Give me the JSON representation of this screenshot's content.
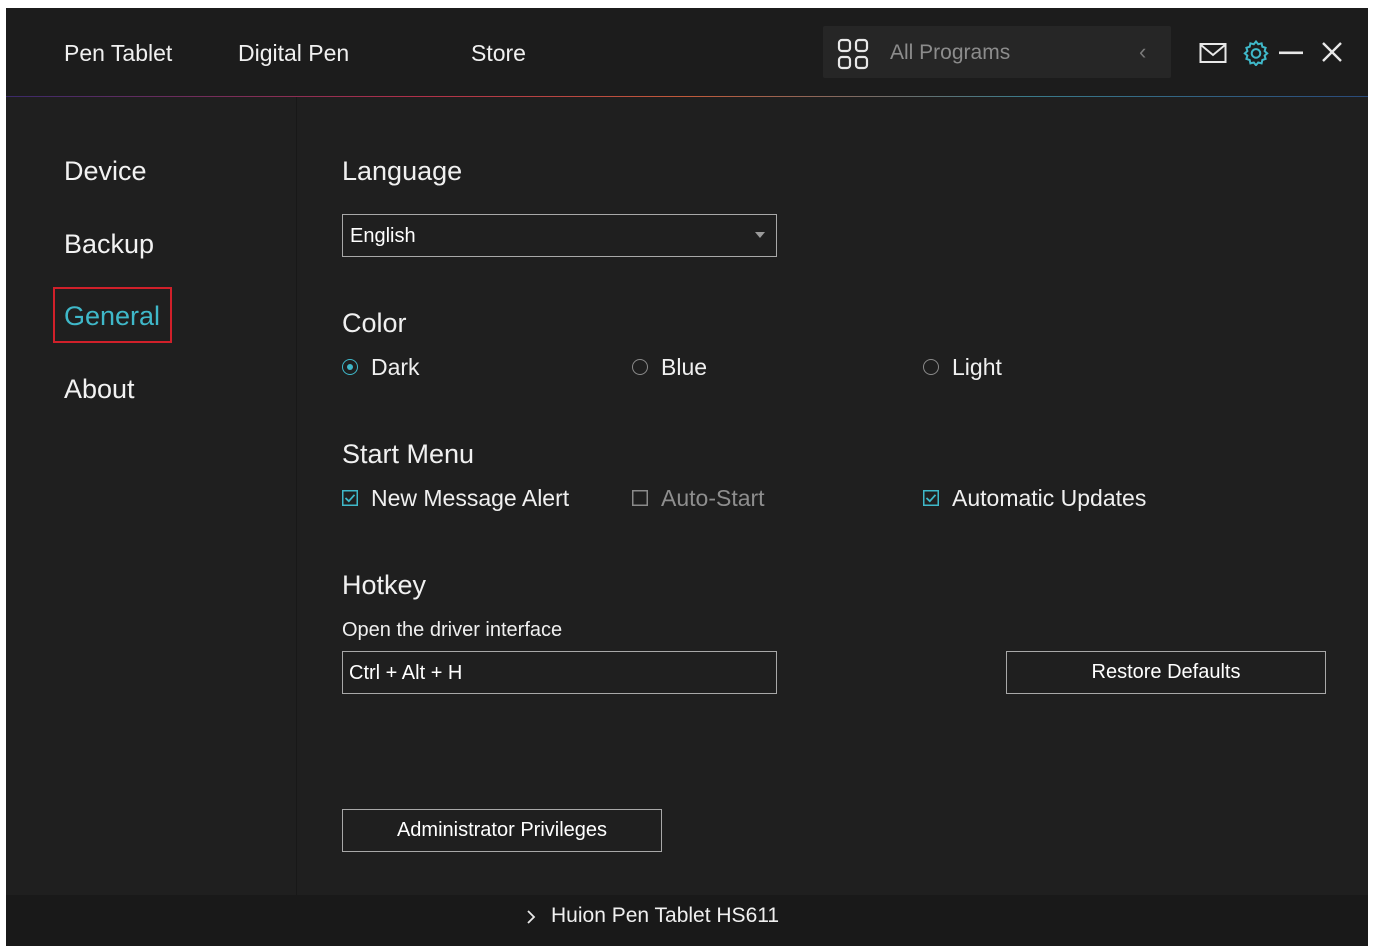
{
  "top_nav": {
    "tabs": [
      {
        "label": "Pen Tablet"
      },
      {
        "label": "Digital Pen"
      },
      {
        "label": "Store"
      }
    ],
    "program_selector": {
      "label": "All Programs"
    },
    "icons": [
      "grid-icon",
      "mail-icon",
      "gear-icon",
      "minimize-icon",
      "close-icon"
    ]
  },
  "sidebar": {
    "items": [
      {
        "label": "Device",
        "active": false
      },
      {
        "label": "Backup",
        "active": false
      },
      {
        "label": "General",
        "active": true
      },
      {
        "label": "About",
        "active": false
      }
    ]
  },
  "main": {
    "language": {
      "title": "Language",
      "value": "English"
    },
    "color": {
      "title": "Color",
      "options": [
        {
          "label": "Dark",
          "selected": true
        },
        {
          "label": "Blue",
          "selected": false
        },
        {
          "label": "Light",
          "selected": false
        }
      ]
    },
    "start_menu": {
      "title": "Start Menu",
      "options": [
        {
          "label": "New Message Alert",
          "checked": true
        },
        {
          "label": "Auto-Start",
          "checked": false
        },
        {
          "label": "Automatic Updates",
          "checked": true
        }
      ]
    },
    "hotkey": {
      "title": "Hotkey",
      "description": "Open the driver interface",
      "value": "Ctrl + Alt + H",
      "restore_label": "Restore Defaults"
    },
    "admin_label": "Administrator Privileges"
  },
  "footer": {
    "device": "Huion Pen Tablet HS611"
  },
  "colors": {
    "accent": "#3fb8c9",
    "background": "#1f1f1f",
    "highlight_outline": "#d0202a"
  }
}
